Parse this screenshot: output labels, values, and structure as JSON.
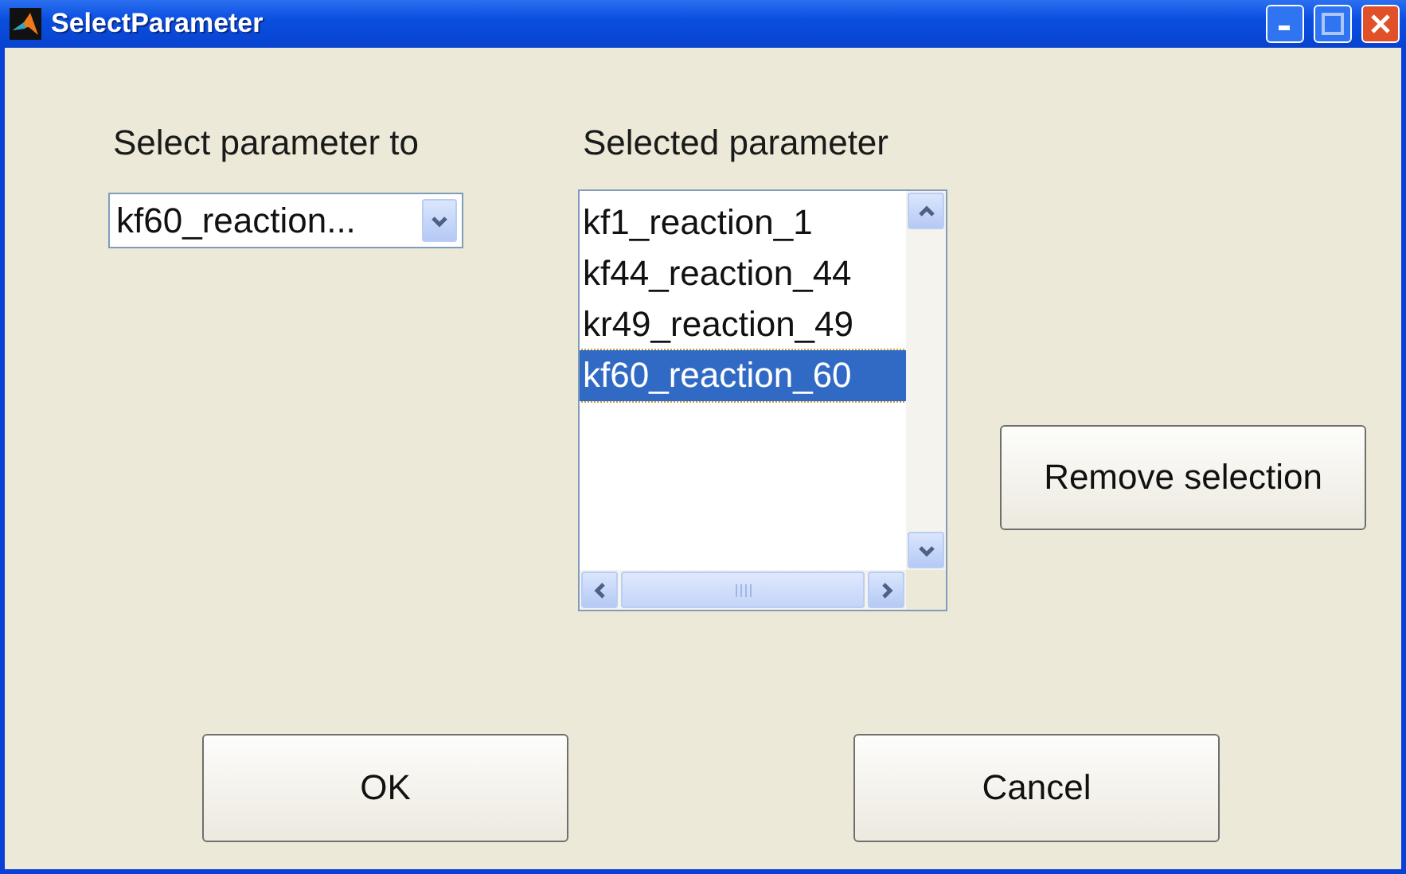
{
  "window": {
    "title": "SelectParameter"
  },
  "left": {
    "label": "Select parameter to",
    "dropdown": {
      "value": "kf60_reaction..."
    }
  },
  "right": {
    "label": "Selected parameter",
    "items": [
      {
        "text": "kf1_reaction_1",
        "selected": false
      },
      {
        "text": "kf44_reaction_44",
        "selected": false
      },
      {
        "text": "kr49_reaction_49",
        "selected": false
      },
      {
        "text": "kf60_reaction_60",
        "selected": true
      }
    ]
  },
  "remove_button": "Remove selection",
  "buttons": [
    "OK",
    "Cancel"
  ]
}
